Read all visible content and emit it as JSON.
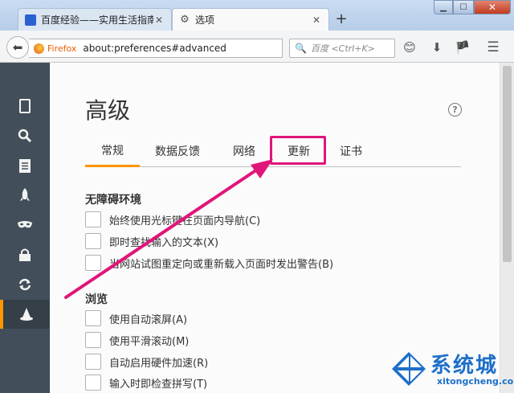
{
  "tabs": [
    {
      "title": "百度经验——实用生活指南",
      "active": false
    },
    {
      "title": "选项",
      "active": true
    }
  ],
  "toolbar": {
    "url_brand": "Firefox",
    "url": "about:preferences#advanced",
    "search_placeholder": "百度 <Ctrl+K>"
  },
  "sidebar": {
    "items": [
      {
        "icon": "general-icon",
        "glyph": "▯"
      },
      {
        "icon": "search-icon",
        "glyph": "🔍"
      },
      {
        "icon": "content-icon",
        "glyph": "☰"
      },
      {
        "icon": "applications-icon",
        "glyph": "🚀"
      },
      {
        "icon": "privacy-icon",
        "glyph": "◉"
      },
      {
        "icon": "security-icon",
        "glyph": "🔒"
      },
      {
        "icon": "sync-icon",
        "glyph": "⟳"
      },
      {
        "icon": "advanced-icon",
        "glyph": "🧙",
        "active": true
      }
    ]
  },
  "page": {
    "title": "高级",
    "tabs": [
      "常规",
      "数据反馈",
      "网络",
      "更新",
      "证书"
    ],
    "selected_tab": "常规",
    "highlighted_tab": "更新"
  },
  "accessibility": {
    "heading": "无障碍环境",
    "options": [
      "始终使用光标键在页面内导航(C)",
      "即时查找输入的文本(X)",
      "当网站试图重定向或重新载入页面时发出警告(B)"
    ]
  },
  "browsing": {
    "heading": "浏览",
    "options": [
      "使用自动滚屏(A)",
      "使用平滑滚动(M)",
      "自动启用硬件加速(R)",
      "输入时即检查拼写(T)"
    ]
  },
  "watermark": {
    "brand": "系统城",
    "url": "xitongcheng.com"
  },
  "colors": {
    "accent": "#ff9500",
    "annotation": "#e0157a",
    "sidebar_bg": "#424f5a"
  }
}
